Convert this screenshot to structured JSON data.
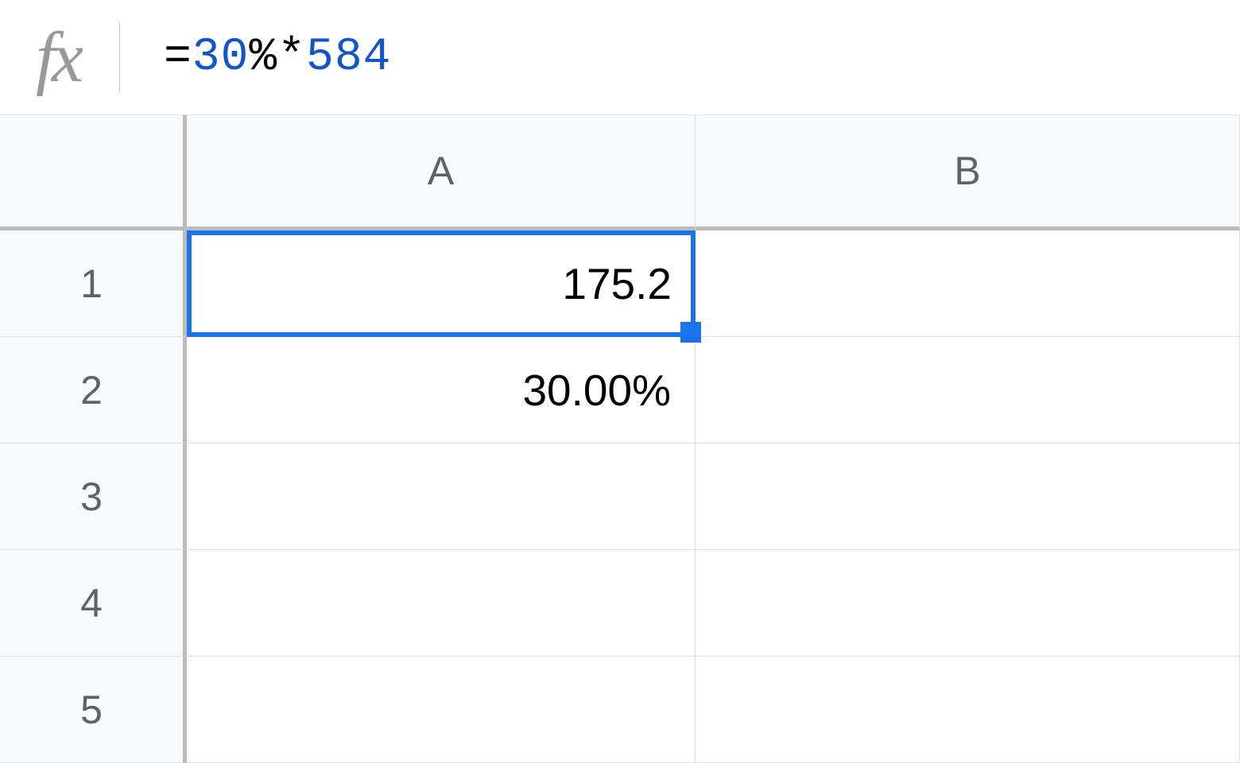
{
  "formula_bar": {
    "fx_label": "fx",
    "formula_tokens": [
      {
        "text": "=",
        "cls": ""
      },
      {
        "text": "30",
        "cls": "blue"
      },
      {
        "text": "%*",
        "cls": ""
      },
      {
        "text": "584",
        "cls": "blue"
      }
    ]
  },
  "columns": [
    "A",
    "B"
  ],
  "rows": [
    "1",
    "2",
    "3",
    "4",
    "5"
  ],
  "cells": {
    "A1": "175.2",
    "A2": "30.00%",
    "A3": "",
    "A4": "",
    "A5": "",
    "B1": "",
    "B2": "",
    "B3": "",
    "B4": "",
    "B5": ""
  },
  "selected_cell": "A1"
}
